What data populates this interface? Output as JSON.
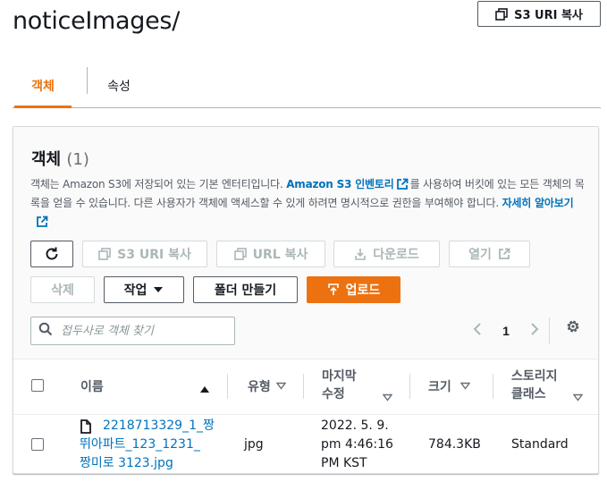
{
  "header": {
    "title": "noticeImages/",
    "copy_uri_label": "S3 URI 복사"
  },
  "tabs": [
    {
      "label": "객체",
      "active": true
    },
    {
      "label": "속성",
      "active": false
    }
  ],
  "objects_panel": {
    "heading": "객체",
    "count": "(1)",
    "description_part1": "객체는 Amazon S3에 저장되어 있는 기본 엔터티입니다. ",
    "inventory_link": "Amazon S3 인벤토리",
    "description_part2": "를 사용하여 버킷에 있는 모든 객체의 목록을 얻을 수 있습니다. 다른 사용자가 객체에 액세스할 수 있게 하려면 명시적으로 권한을 부여해야 합니다. ",
    "learn_more_link": "자세히 알아보기"
  },
  "toolbar": {
    "refresh_icon": "refresh-icon",
    "copy_s3_uri": "S3 URI 복사",
    "copy_url": "URL 복사",
    "download": "다운로드",
    "open": "열기",
    "delete": "삭제",
    "actions": "작업",
    "create_folder": "폴더 만들기",
    "upload": "업로드"
  },
  "search": {
    "placeholder": "접두사로 객체 찾기"
  },
  "pagination": {
    "current_page": "1"
  },
  "table": {
    "columns": {
      "name": "이름",
      "type": "유형",
      "last_modified_line1": "마지막",
      "last_modified_line2": "수정",
      "size": "크기",
      "storage_class_line1": "스토리지",
      "storage_class_line2": "클래스"
    },
    "rows": [
      {
        "name_line1": "2218713329_1_짱",
        "name_line2": "뛰아파트_123_1231_",
        "name_line3": "짱미로 3123.jpg",
        "type": "jpg",
        "modified_line1": "2022. 5. 9.",
        "modified_line2": "pm 4:46:16",
        "modified_line3": "PM KST",
        "size": "784.3KB",
        "storage_class": "Standard"
      }
    ]
  },
  "colors": {
    "accent": "#ec7211",
    "link": "#0073bb",
    "disabled": "#aab7b8"
  }
}
